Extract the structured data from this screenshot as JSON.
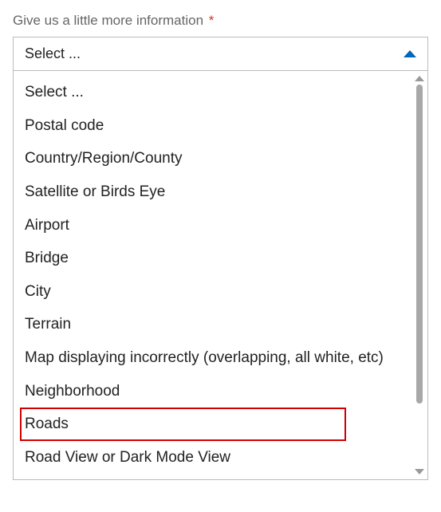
{
  "field": {
    "label": "Give us a little more information",
    "required_mark": "*"
  },
  "select": {
    "value": "Select ...",
    "options": [
      "Select ...",
      "Postal code",
      "Country/Region/County",
      "Satellite or Birds Eye",
      "Airport",
      "Bridge",
      "City",
      "Terrain",
      "Map displaying incorrectly (overlapping, all white, etc)",
      "Neighborhood",
      "Roads",
      "Road View or Dark Mode View"
    ],
    "highlighted_index": 10
  }
}
